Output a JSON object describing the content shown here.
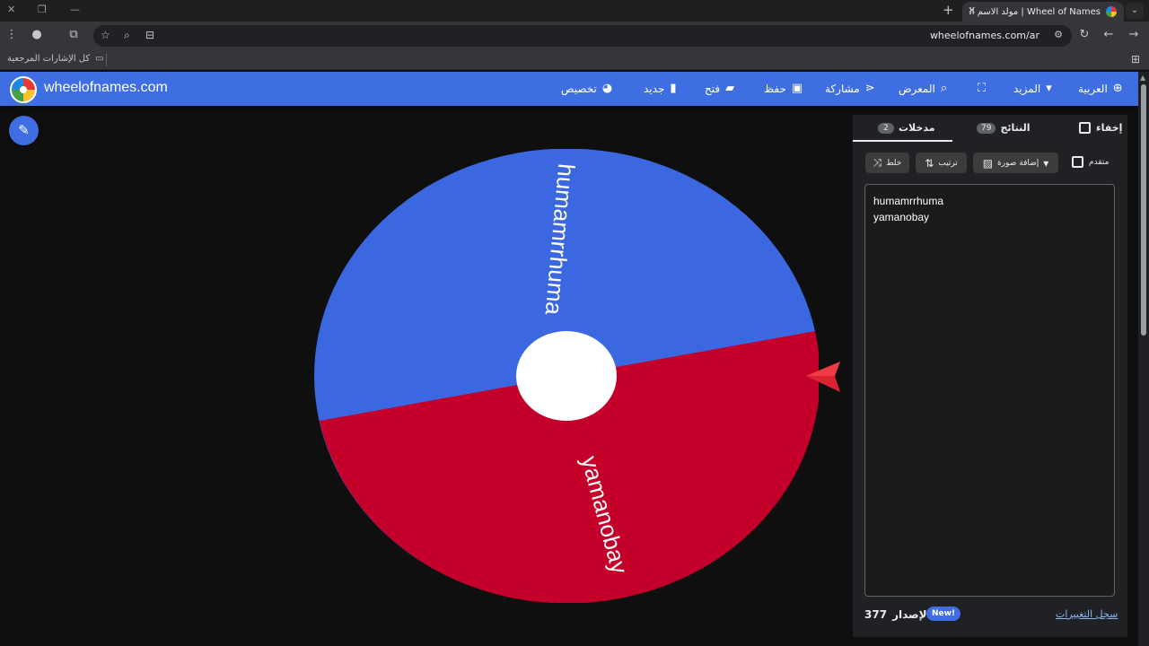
{
  "browser": {
    "tab_title": "Wheel of Names | مولد الاسم العشوائي",
    "tab_close": "✕",
    "new_tab": "+",
    "url": "wheelofnames.com/ar",
    "bookmarks_all": "كل الإشارات المرجعية"
  },
  "navbar": {
    "brand": "wheelofnames.com",
    "language": "العربية",
    "more": "المزيد",
    "gallery": "المعرض",
    "share": "مشاركة",
    "save": "حفظ",
    "open": "فتح",
    "new": "جديد",
    "customize": "تخصيص"
  },
  "panel": {
    "hide_label": "إخفاء",
    "results_label": "النتائج",
    "results_count": "79",
    "entries_label": "مدخلات",
    "entries_count": "2",
    "shuffle_label": "خلط",
    "sort_label": "ترتيب",
    "add_image_label": "إضافة صورة",
    "advanced_label": "متقدم",
    "entries": [
      "humamrrhuma",
      "yamanobay"
    ],
    "changelog": "سجل التغييرات",
    "version_label": "الإصدار",
    "version_number": "377",
    "new_badge": "New!"
  },
  "wheel": {
    "segments": [
      {
        "label": "humamrrhuma",
        "color": "#3b67e0"
      },
      {
        "label": "yamanobay",
        "color": "#c4002a"
      }
    ],
    "pointer_color": "#d92332"
  },
  "icons": {
    "edit": "pencil-icon",
    "globe": "globe-icon",
    "fullscreen": "fullscreen-icon",
    "search": "search-icon",
    "share": "share-icon",
    "save": "floppy-icon",
    "open": "folder-icon",
    "new": "file-icon",
    "customize": "palette-icon"
  }
}
